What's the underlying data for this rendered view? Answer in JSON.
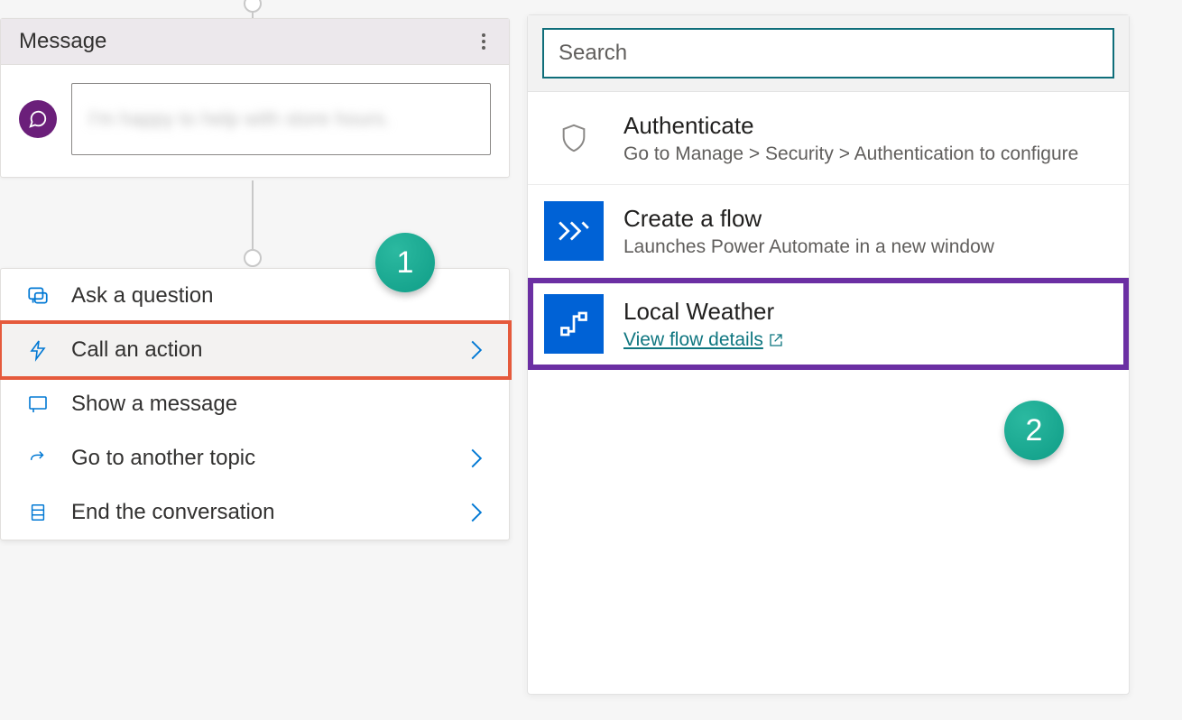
{
  "message_card": {
    "title": "Message",
    "body_text": "I'm happy to help with store hours."
  },
  "node_menu": {
    "items": [
      {
        "label": "Ask a question",
        "has_chevron": false
      },
      {
        "label": "Call an action",
        "has_chevron": true,
        "highlight": true
      },
      {
        "label": "Show a message",
        "has_chevron": false
      },
      {
        "label": "Go to another topic",
        "has_chevron": true
      },
      {
        "label": "End the conversation",
        "has_chevron": true
      }
    ]
  },
  "right_panel": {
    "search_placeholder": "Search",
    "actions": [
      {
        "title": "Authenticate",
        "subtitle": "Go to Manage > Security > Authentication to configure",
        "icon": "shield",
        "style": "plain"
      },
      {
        "title": "Create a flow",
        "subtitle": "Launches Power Automate in a new window",
        "icon": "flow-run",
        "style": "blue"
      },
      {
        "title": "Local Weather",
        "link_label": "View flow details",
        "icon": "flow",
        "style": "blue",
        "selected": true
      }
    ]
  },
  "callouts": {
    "one": "1",
    "two": "2"
  }
}
